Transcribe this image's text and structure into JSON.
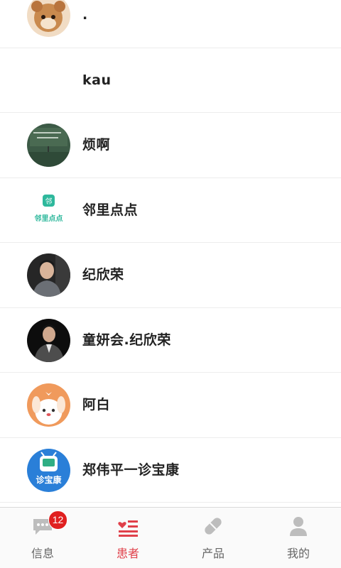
{
  "contacts": [
    {
      "name": ".",
      "avatar": "cat-avatar"
    },
    {
      "name": "kau",
      "avatar": "none"
    },
    {
      "name": "烦啊",
      "avatar": "chalkboard-avatar"
    },
    {
      "name": "邻里点点",
      "avatar": "linli-logo-avatar"
    },
    {
      "name": "纪欣荣",
      "avatar": "man-photo-avatar"
    },
    {
      "name": "童妍会.纪欣荣",
      "avatar": "man-suit-avatar"
    },
    {
      "name": "阿白",
      "avatar": "cartoon-dog-avatar"
    },
    {
      "name": "郑伟平一诊宝康",
      "avatar": "zhenbaokang-logo-avatar"
    }
  ],
  "tabbar": {
    "tabs": [
      {
        "label": "信息",
        "icon": "message-icon",
        "badge": "12",
        "active": false
      },
      {
        "label": "患者",
        "icon": "patients-list-icon",
        "active": true
      },
      {
        "label": "产品",
        "icon": "pill-icon",
        "active": false
      },
      {
        "label": "我的",
        "icon": "user-icon",
        "active": false
      }
    ]
  },
  "logos": {
    "linli_text": "邻里点点",
    "zhenbaokang_text": "诊宝康"
  },
  "colors": {
    "accent": "#e0404a",
    "inactive": "#666666",
    "icon_inactive": "#bdbdbd",
    "badge": "#e02020"
  }
}
